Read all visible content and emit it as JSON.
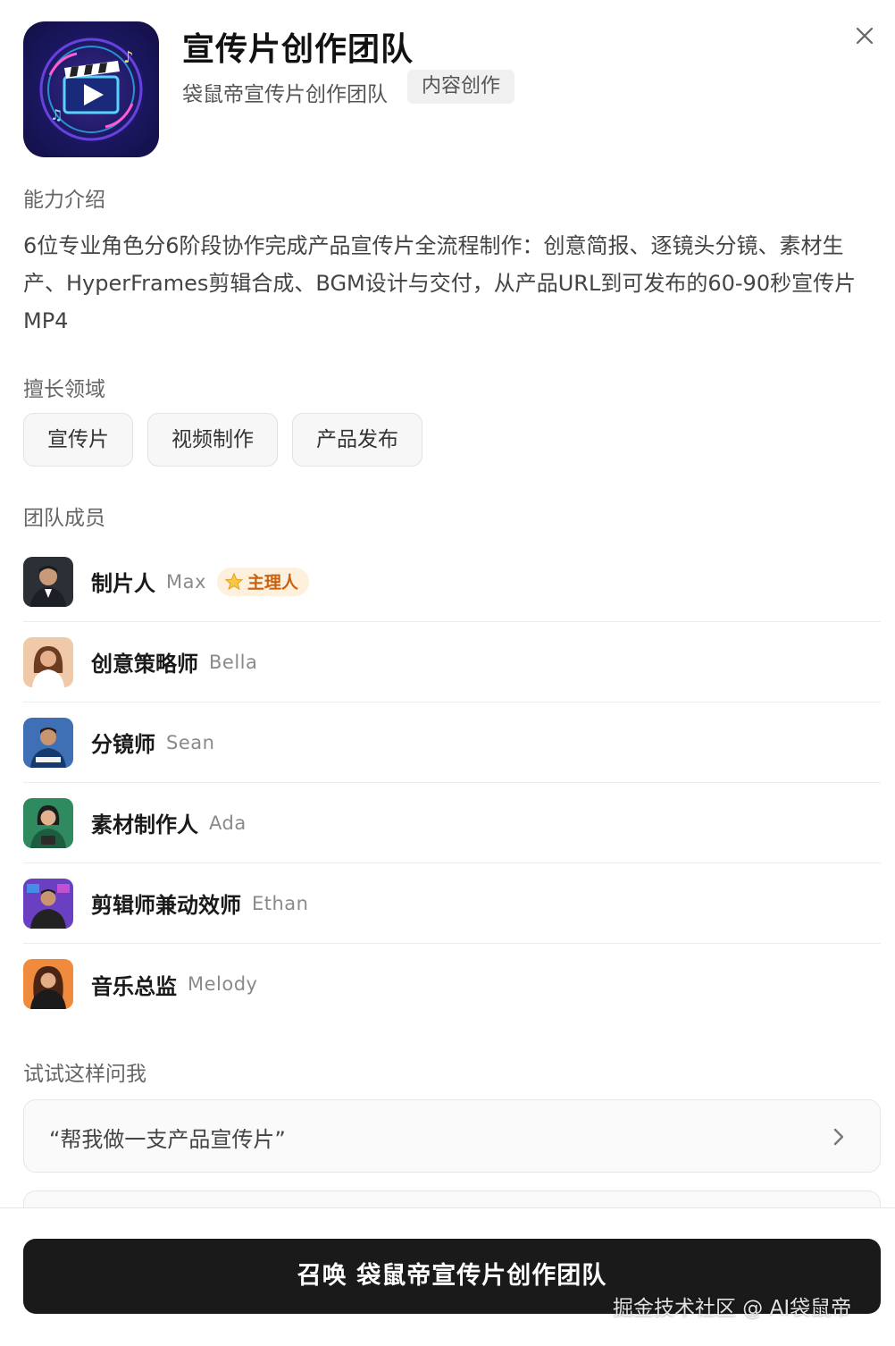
{
  "header": {
    "title": "宣传片创作团队",
    "subtitle": "袋鼠帝宣传片创作团队",
    "category": "内容创作",
    "close_icon": "close-icon",
    "logo_icon": "film-clapper-icon"
  },
  "ability": {
    "heading": "能力介绍",
    "text": "6位专业角色分6阶段协作完成产品宣传片全流程制作：创意简报、逐镜头分镜、素材生产、HyperFrames剪辑合成、BGM设计与交付，从产品URL到可发布的60-90秒宣传片MP4"
  },
  "domains": {
    "heading": "擅长领域",
    "tags": [
      "宣传片",
      "视频制作",
      "产品发布"
    ]
  },
  "team": {
    "heading": "团队成员",
    "leader_label": "主理人",
    "members": [
      {
        "role": "制片人",
        "name": "Max",
        "avatar_color": "#2b2f36"
      },
      {
        "role": "创意策略师",
        "name": "Bella",
        "avatar_color": "#f0c9a8"
      },
      {
        "role": "分镜师",
        "name": "Sean",
        "avatar_color": "#3f6fb5"
      },
      {
        "role": "素材制作人",
        "name": "Ada",
        "avatar_color": "#2f8a5f"
      },
      {
        "role": "剪辑师兼动效师",
        "name": "Ethan",
        "avatar_color": "#6a3fc2"
      },
      {
        "role": "音乐总监",
        "name": "Melody",
        "avatar_color": "#f08a3c"
      }
    ]
  },
  "prompts": {
    "heading": "试试这样问我",
    "items": [
      "“帮我做一支产品宣传片”"
    ]
  },
  "footer": {
    "button_label": "召唤 袋鼠帝宣传片创作团队",
    "watermark": "掘金技术社区 @ AI袋鼠帝"
  },
  "colors": {
    "button_bg": "#1a1a1a",
    "leader_badge_bg": "#fdf0dd",
    "leader_badge_text": "#c8620e"
  }
}
